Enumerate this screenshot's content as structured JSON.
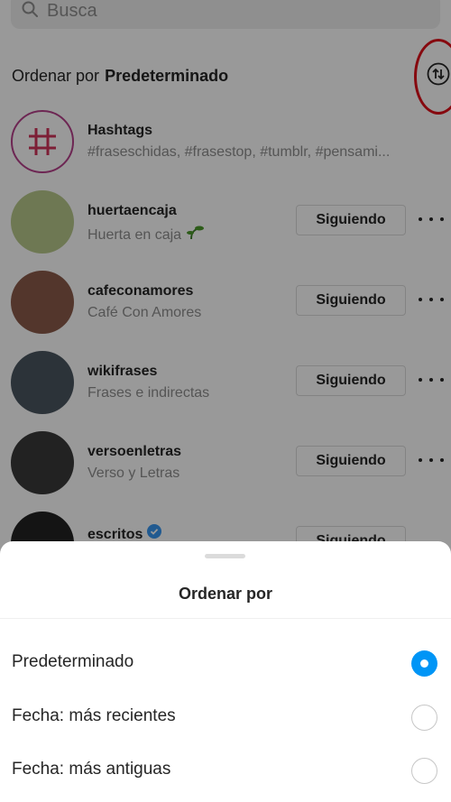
{
  "search": {
    "placeholder": "Busca"
  },
  "sort": {
    "prefix": "Ordenar por",
    "value": "Predeterminado"
  },
  "list": [
    {
      "name": "Hashtags",
      "subtitle": "#fraseschidas, #frasestop, #tumblr, #pensami..."
    },
    {
      "name": "huertaencaja",
      "subtitle": "Huerta en caja",
      "button": "Siguiendo"
    },
    {
      "name": "cafeconamores",
      "subtitle": "Café Con Amores",
      "button": "Siguiendo"
    },
    {
      "name": "wikifrases",
      "subtitle": "Frases e indirectas",
      "button": "Siguiendo"
    },
    {
      "name": "versoenletras",
      "subtitle": "Verso y Letras",
      "button": "Siguiendo"
    },
    {
      "name": "escritos",
      "subtitle": "",
      "button": "Siguiendo"
    }
  ],
  "sheet": {
    "title": "Ordenar por",
    "options": [
      {
        "label": "Predeterminado",
        "selected": true
      },
      {
        "label": "Fecha: más recientes",
        "selected": false
      },
      {
        "label": "Fecha: más antiguas",
        "selected": false
      }
    ]
  },
  "colors": {
    "accent": "#0095f6",
    "highlight_ring": "#e0101a",
    "muted": "#8e8e8e"
  },
  "icons": [
    "search-icon",
    "sort-arrows-icon",
    "hashtag-icon",
    "seedling-icon",
    "verified-badge-icon",
    "more-icon"
  ]
}
